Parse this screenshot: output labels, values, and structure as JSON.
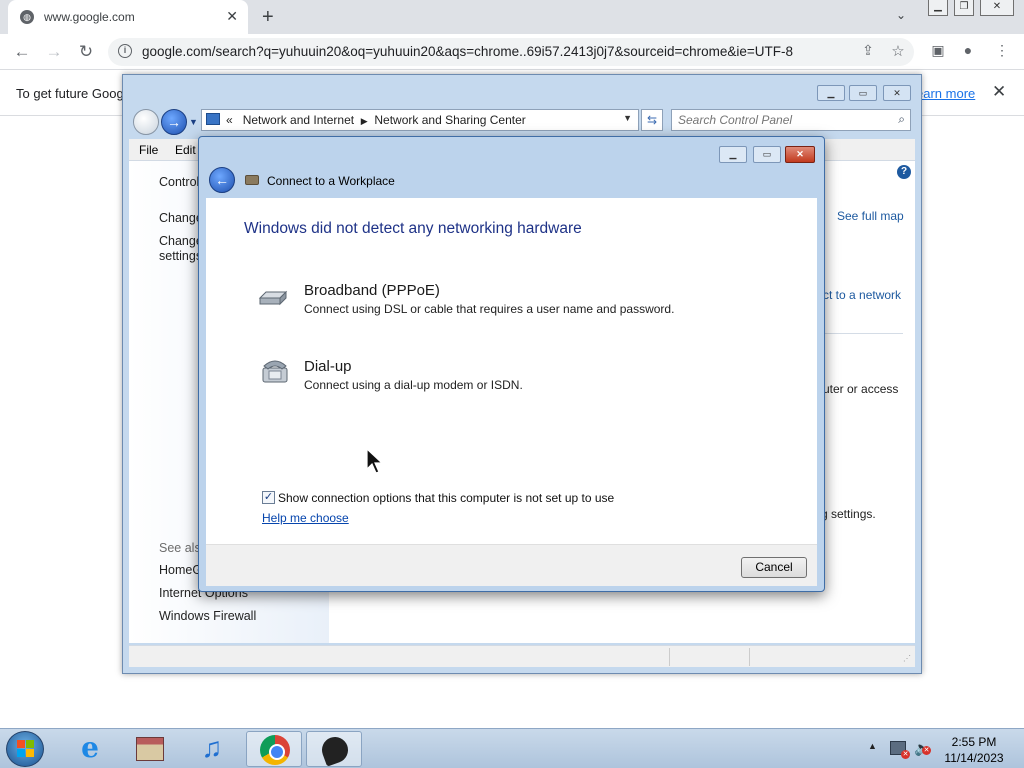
{
  "browser": {
    "tab_title": "www.google.com",
    "url": "google.com/search?q=yuhuuin20&oq=yuhuuin20&aqs=chrome..69i57.2413j0j7&sourceid=chrome&ie=UTF-8",
    "infobar_text": "To get future Goog",
    "infobar_link": "earn more"
  },
  "explorer": {
    "breadcrumb_prefix": "«",
    "breadcrumb": [
      "Network and Internet",
      "Network and Sharing Center"
    ],
    "search_placeholder": "Search Control Panel",
    "menu": [
      "File",
      "Edit"
    ],
    "left_items": [
      "Control",
      "Change",
      "Change",
      "settings"
    ],
    "see_also_label": "See also",
    "see_also": [
      "HomeG",
      "Internet Options",
      "Windows Firewall"
    ],
    "right_items": [
      "See full map",
      "ct to a network",
      "uter or access",
      "g settings."
    ]
  },
  "dialog": {
    "title": "Connect to a Workplace",
    "heading": "Windows did not detect any networking hardware",
    "options": [
      {
        "title": "Broadband (PPPoE)",
        "desc": "Connect using DSL or cable that requires a user name and password.",
        "icon": "modem-icon"
      },
      {
        "title": "Dial-up",
        "desc": "Connect using a dial-up modem or ISDN.",
        "icon": "telephone-icon"
      }
    ],
    "show_options_label": "Show connection options that this computer is not set up to use",
    "show_options_checked": true,
    "help_link": "Help me choose",
    "cancel_label": "Cancel"
  },
  "taskbar": {
    "time": "2:55 PM",
    "date": "11/14/2023"
  }
}
